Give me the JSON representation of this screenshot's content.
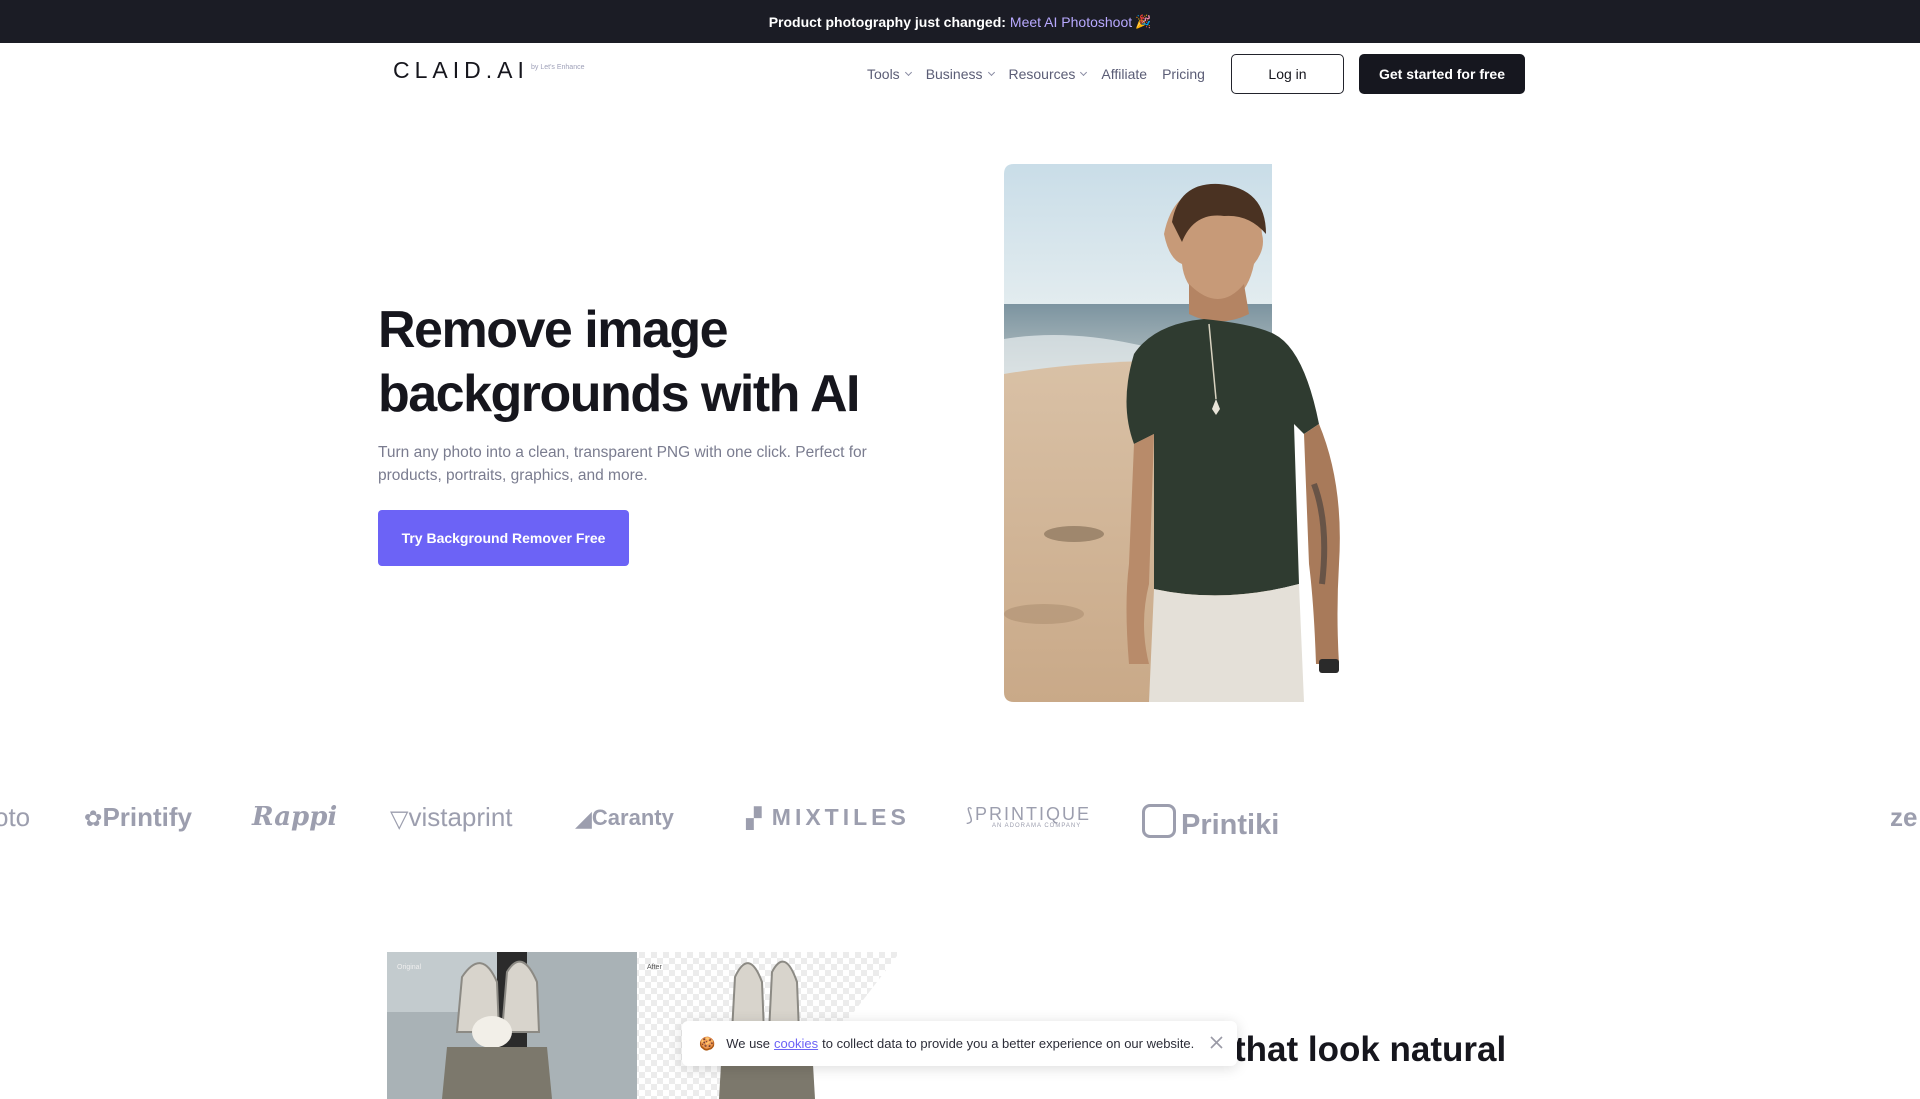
{
  "announcement": {
    "text": "Product photography just changed:",
    "link": "Meet AI Photoshoot",
    "emoji": "🎉"
  },
  "header": {
    "logo": "CLAID.AI",
    "logo_sub": "by Let's Enhance",
    "nav": [
      {
        "label": "Tools",
        "icon": "chevron-down-icon"
      },
      {
        "label": "Business",
        "icon": "chevron-down-icon"
      },
      {
        "label": "Resources",
        "icon": "chevron-down-icon"
      },
      {
        "label": "Affiliate"
      },
      {
        "label": "Pricing"
      }
    ],
    "login": "Log in",
    "cta": "Get started for free"
  },
  "hero": {
    "title_line1": "Remove image",
    "title_line2": "backgrounds with AI",
    "description": "Turn any photo into a clean, transparent PNG with one click. Perfect for products, portraits, graphics, and more.",
    "cta": "Try Background Remover Free",
    "image": "man-on-beach-photo"
  },
  "brands": [
    "oto",
    "Printify",
    "Rappi",
    "vistaprint",
    "Caranty",
    "MIXTILES",
    "PRINTIQUE",
    "Printiki",
    "ze"
  ],
  "brands_sub": {
    "printique_tagline": "AN ADORAMA COMPANY"
  },
  "comparison": {
    "before_label": "Original",
    "after_label": "After"
  },
  "section": {
    "title_partial": "that look natural"
  },
  "cookie": {
    "emoji": "🍪",
    "text_before": "We use",
    "link": "cookies",
    "text_after": "to collect data to provide you a better experience on our website."
  },
  "colors": {
    "accent": "#6c63f6",
    "dark": "#16171f",
    "announce_bg": "#1b1c25",
    "link_purple": "#b8a9ff"
  }
}
